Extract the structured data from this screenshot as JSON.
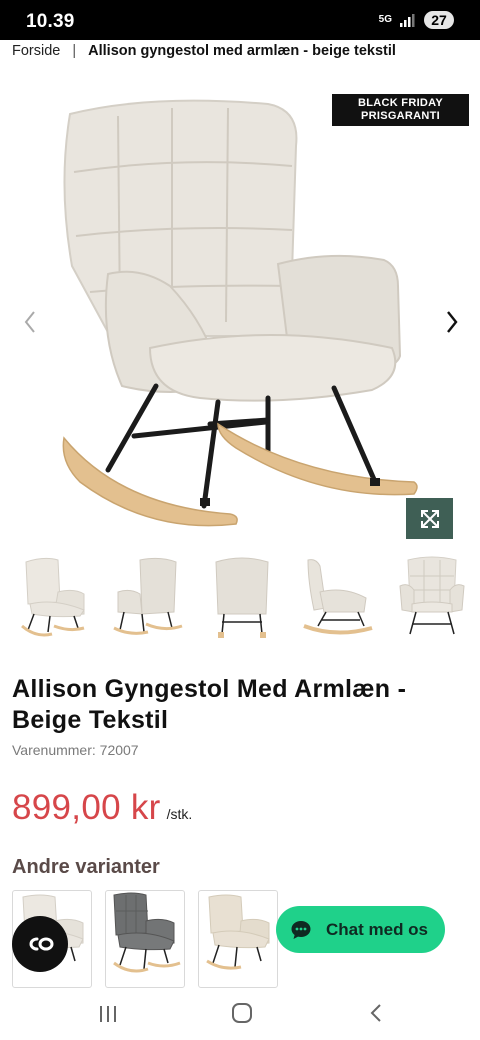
{
  "status_bar": {
    "time": "10.39",
    "network": "5G",
    "battery": "27"
  },
  "breadcrumb": {
    "home": "Forside",
    "separator": "|",
    "current": "Allison gyngestol med armlæn - beige tekstil"
  },
  "product": {
    "badge_line1": "BLACK FRIDAY",
    "badge_line2": "PRISGARANTI",
    "title": "Allison Gyngestol Med Armlæn - Beige Tekstil",
    "sku": "Varenummer: 72007",
    "price": "899,00 kr",
    "unit": "/stk."
  },
  "variants": {
    "heading": "Andre varianter"
  },
  "chat": {
    "label": "Chat med os"
  },
  "colors": {
    "price": "#d6464a",
    "chat_bg": "#1fd18a",
    "zoom_bg": "#3f5f55",
    "chair_beige": "#e9e5de",
    "chair_grey": "#6d6f70",
    "wood": "#e3c08f"
  },
  "icons": [
    "chevron-left-icon",
    "chevron-right-icon",
    "expand-icon",
    "chat-bubble-icon",
    "co-logo-icon",
    "recent-apps-icon",
    "home-icon",
    "back-icon"
  ]
}
